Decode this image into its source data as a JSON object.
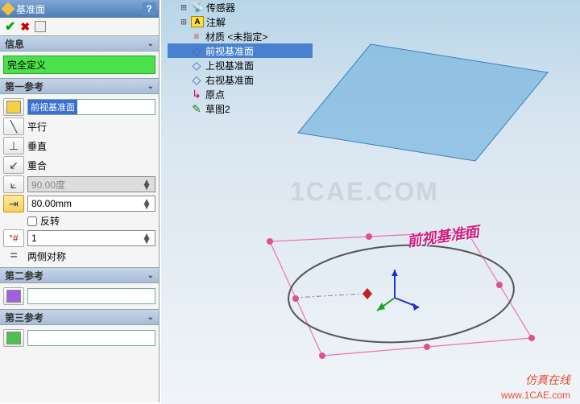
{
  "panel": {
    "title": "基准面",
    "info_label": "信息",
    "fully_defined": "完全定义",
    "ref1_label": "第一参考",
    "ref1_selection": "前视基准面",
    "parallel": "平行",
    "perpendicular": "垂直",
    "coincident": "重合",
    "angle_value": "90.00度",
    "offset_value": "80.00mm",
    "flip_label": "反转",
    "count_value": "1",
    "midplane_label": "两侧对称",
    "ref2_label": "第二参考",
    "ref3_label": "第三参考"
  },
  "tree": {
    "item0": "传感器",
    "annotations": "注解",
    "material": "材质 <未指定>",
    "front_plane": "前视基准面",
    "top_plane": "上视基准面",
    "right_plane": "右视基准面",
    "origin": "原点",
    "sketch": "草图2"
  },
  "view": {
    "plane_name": "前视基准面"
  },
  "branding": {
    "watermark": "1CAE.COM",
    "footer_text": "仿真在线",
    "footer_url": "www.1CAE.com"
  }
}
